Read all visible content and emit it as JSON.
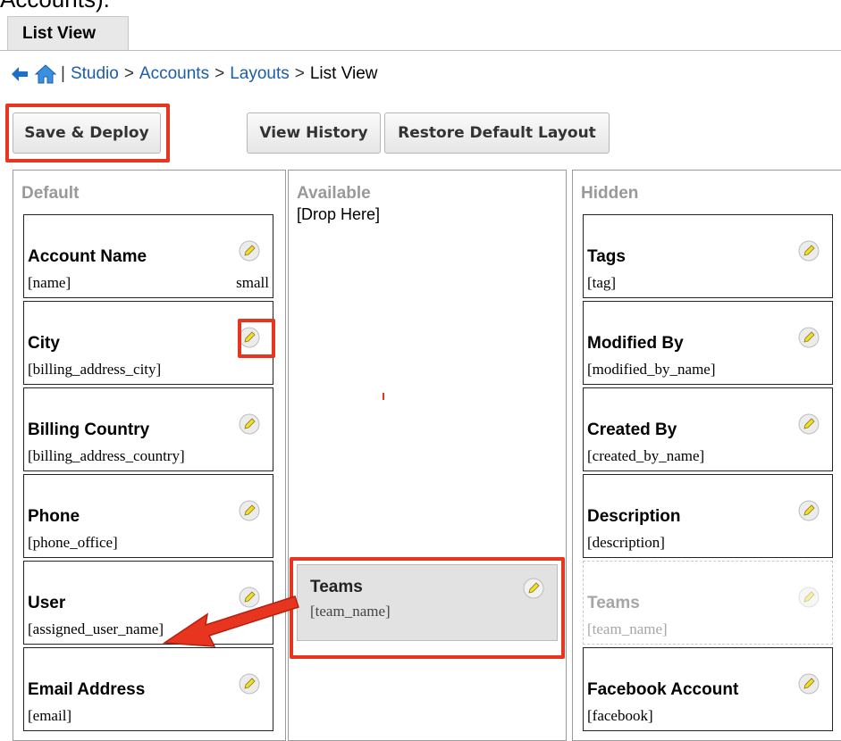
{
  "clipped_text": "Accounts).",
  "tab": {
    "label": "List View"
  },
  "breadcrumb": {
    "items": [
      "Studio",
      "Accounts",
      "Layouts"
    ],
    "current": "List View",
    "pipe": "|",
    "sep": ">"
  },
  "toolbar": {
    "save_deploy": "Save & Deploy",
    "view_history": "View History",
    "restore_default": "Restore Default Layout"
  },
  "columns": {
    "default": {
      "title": "Default",
      "cards": [
        {
          "title": "Account Name",
          "field": "[name]",
          "size": "small"
        },
        {
          "title": "City",
          "field": "[billing_address_city]"
        },
        {
          "title": "Billing Country",
          "field": "[billing_address_country]"
        },
        {
          "title": "Phone",
          "field": "[phone_office]"
        },
        {
          "title": "User",
          "field": "[assigned_user_name]"
        },
        {
          "title": "Email Address",
          "field": "[email]"
        }
      ]
    },
    "available": {
      "title": "Available",
      "drop_here": "[Drop Here]",
      "dragging_card": {
        "title": "Teams",
        "field": "[team_name]"
      }
    },
    "hidden": {
      "title": "Hidden",
      "cards": [
        {
          "title": "Tags",
          "field": "[tag]"
        },
        {
          "title": "Modified By",
          "field": "[modified_by_name]"
        },
        {
          "title": "Created By",
          "field": "[created_by_name]"
        },
        {
          "title": "Description",
          "field": "[description]"
        },
        {
          "title": "Teams",
          "field": "[team_name]"
        },
        {
          "title": "Facebook Account",
          "field": "[facebook]"
        }
      ]
    }
  },
  "colors": {
    "highlight": "#e8351f",
    "link": "#1b5ea8",
    "muted_title": "#999999"
  }
}
